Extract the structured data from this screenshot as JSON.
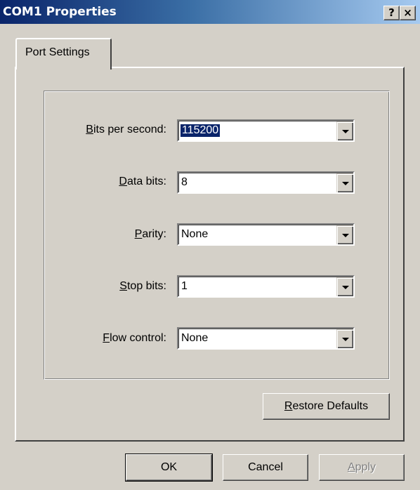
{
  "window": {
    "title": "COM1 Properties",
    "help_label": "?",
    "close_label": "×"
  },
  "tabs": [
    {
      "label": "Port Settings",
      "selected": true
    }
  ],
  "fields": [
    {
      "label": "Bits per second:",
      "mnemonic": "B",
      "value": "115200",
      "selected": true
    },
    {
      "label": "Data bits:",
      "mnemonic": "D",
      "value": "8",
      "selected": false
    },
    {
      "label": "Parity:",
      "mnemonic": "P",
      "value": "None",
      "selected": false
    },
    {
      "label": "Stop bits:",
      "mnemonic": "S",
      "value": "1",
      "selected": false
    },
    {
      "label": "Flow control:",
      "mnemonic": "F",
      "value": "None",
      "selected": false
    }
  ],
  "buttons": {
    "restore_defaults": "Restore Defaults",
    "ok": "OK",
    "cancel": "Cancel",
    "apply": "Apply"
  },
  "colors": {
    "titlebar_start": "#0a246a",
    "titlebar_end": "#a6caf0",
    "face": "#d4d0c8",
    "selection": "#0a246a"
  }
}
